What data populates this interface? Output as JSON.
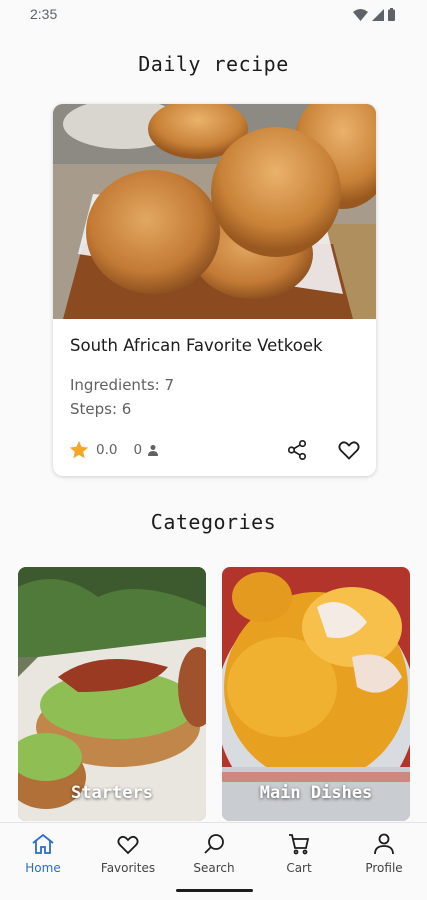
{
  "status_bar": {
    "time": "2:35"
  },
  "daily_recipe": {
    "section_title": "Daily recipe",
    "name": "South African Favorite Vetkoek",
    "ingredients_text": "Ingredients: 7",
    "steps_text": "Steps: 6",
    "rating": "0.0",
    "reviews_count": "0"
  },
  "categories": {
    "section_title": "Categories",
    "items": [
      {
        "label": "Starters"
      },
      {
        "label": "Main Dishes"
      }
    ]
  },
  "nav": {
    "items": [
      {
        "label": "Home",
        "icon": "home-icon",
        "active": true
      },
      {
        "label": "Favorites",
        "icon": "heart-icon",
        "active": false
      },
      {
        "label": "Search",
        "icon": "search-icon",
        "active": false
      },
      {
        "label": "Cart",
        "icon": "cart-icon",
        "active": false
      },
      {
        "label": "Profile",
        "icon": "person-icon",
        "active": false
      }
    ]
  },
  "colors": {
    "accent": "#2a6ec9",
    "star": "#f5a623",
    "text": "#1c1c1c",
    "muted": "#616161"
  }
}
